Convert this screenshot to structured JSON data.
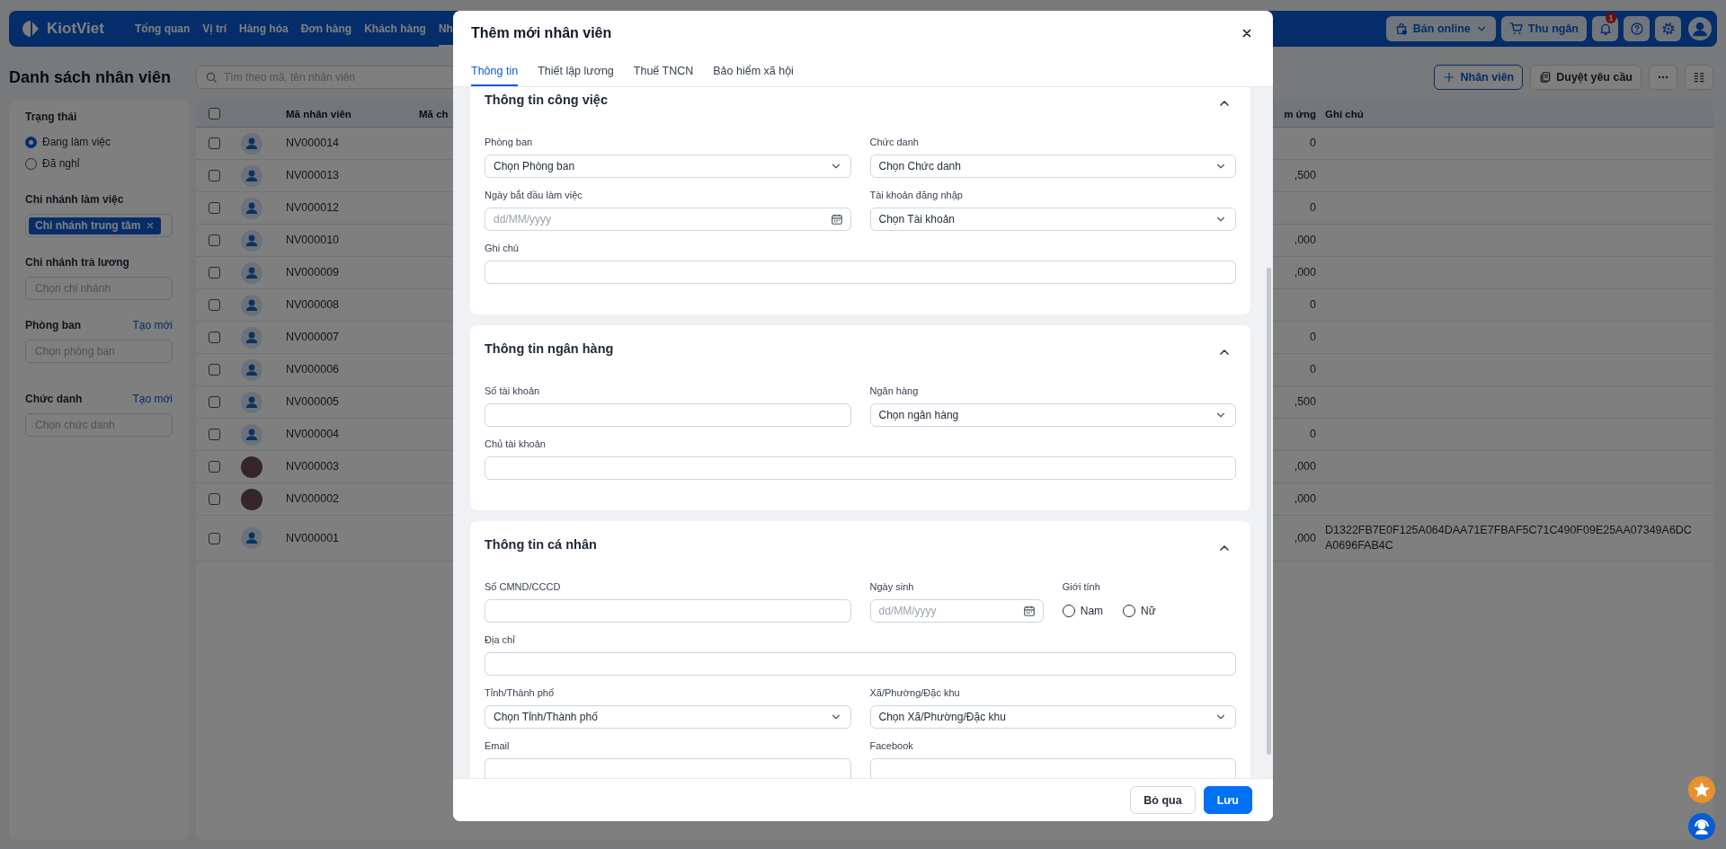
{
  "top_nav": {
    "logo": "KiotViet",
    "items": [
      {
        "label": "Tổng quan",
        "selected": false
      },
      {
        "label": "Vị trí",
        "selected": false
      },
      {
        "label": "Hàng hóa",
        "selected": false
      },
      {
        "label": "Đơn hàng",
        "selected": false
      },
      {
        "label": "Khách hàng",
        "selected": false
      },
      {
        "label": "Nh",
        "selected": true
      }
    ],
    "actions": [
      {
        "kind": "online",
        "label": "Bán online"
      },
      {
        "kind": "cashier",
        "label": "Thu ngân"
      },
      {
        "kind": "notifications",
        "badge": "1"
      },
      {
        "kind": "help"
      },
      {
        "kind": "settings"
      },
      {
        "kind": "account"
      }
    ]
  },
  "page": {
    "title": "Danh sách nhân viên",
    "search": {
      "placeholder": "Tìm theo mã, tên nhân viên"
    },
    "actions": [
      {
        "kind": "add",
        "label": "Nhân viên"
      },
      {
        "kind": "requests",
        "label": "Duyệt yêu cầu"
      },
      {
        "kind": "more"
      },
      {
        "kind": "layout"
      }
    ]
  },
  "filters": [
    {
      "kind": "radio",
      "title": "Trạng thái",
      "options": [
        {
          "label": "Đang làm việc",
          "selected": true
        },
        {
          "label": "Đã nghỉ",
          "selected": false
        }
      ]
    },
    {
      "kind": "tags",
      "title": "Chi nhánh làm việc",
      "tags": [
        "Chi nhánh trung tâm"
      ]
    },
    {
      "kind": "select",
      "title": "Chi nhánh trả lương",
      "placeholder": "Chọn chi nhánh"
    },
    {
      "kind": "select",
      "title": "Phòng ban",
      "link": "Tạo mới",
      "placeholder": "Chọn phòng ban"
    },
    {
      "kind": "select",
      "title": "Chức danh",
      "link": "Tạo mới",
      "placeholder": "Chọn chức danh"
    }
  ],
  "table": {
    "header_checkbox": {
      "checked": false
    },
    "columns": [
      {
        "kind": "code",
        "label": "Mã nhân viên"
      },
      {
        "kind": "hidden",
        "label": "Mã ch"
      },
      {
        "kind": "amount",
        "label": "m ứng"
      },
      {
        "kind": "note",
        "label": "Ghi chú"
      }
    ],
    "rows": [
      {
        "checked": false,
        "has_photo": false,
        "code": "NV000014",
        "amount": "0"
      },
      {
        "checked": false,
        "has_photo": false,
        "code": "NV000013",
        "amount": ",500"
      },
      {
        "checked": false,
        "has_photo": false,
        "code": "NV000012",
        "amount": "0"
      },
      {
        "checked": false,
        "has_photo": false,
        "code": "NV000010",
        "amount": ",000"
      },
      {
        "checked": false,
        "has_photo": false,
        "code": "NV000009",
        "amount": ",000"
      },
      {
        "checked": false,
        "has_photo": false,
        "code": "NV000008",
        "amount": "0"
      },
      {
        "checked": false,
        "has_photo": false,
        "code": "NV000007",
        "amount": "0"
      },
      {
        "checked": false,
        "has_photo": false,
        "code": "NV000006",
        "amount": "0"
      },
      {
        "checked": false,
        "has_photo": false,
        "code": "NV000005",
        "amount": ",500"
      },
      {
        "checked": false,
        "has_photo": false,
        "code": "NV000004",
        "amount": "0"
      },
      {
        "checked": false,
        "has_photo": true,
        "code": "NV000003",
        "amount": ",000"
      },
      {
        "checked": false,
        "has_photo": true,
        "code": "NV000002",
        "amount": ",000"
      },
      {
        "checked": false,
        "has_photo": false,
        "code": "NV000001",
        "amount": ",000",
        "note": "D1322FB7E0F125A064DAA71E7FBAF5C71C490F09E25AA07349A6DCA0696FAB4C"
      }
    ]
  },
  "modal": {
    "title": "Thêm mới nhân viên",
    "tabs": [
      {
        "label": "Thông tin",
        "selected": true
      },
      {
        "label": "Thiết lập lương",
        "selected": false
      },
      {
        "label": "Thuế TNCN",
        "selected": false
      },
      {
        "label": "Bảo hiểm xã hội",
        "selected": false
      }
    ],
    "sections": [
      {
        "title": "Thông tin công việc",
        "expanded": true,
        "rows": [
          [
            {
              "kind": "select",
              "label": "Phòng ban",
              "value": "Chọn Phòng ban"
            },
            {
              "kind": "select",
              "label": "Chức danh",
              "value": "Chọn Chức danh"
            }
          ],
          [
            {
              "kind": "date",
              "label": "Ngày bắt đầu làm việc",
              "placeholder": "dd/MM/yyyy"
            },
            {
              "kind": "select",
              "label": "Tài khoản đăng nhập",
              "value": "Chọn Tài khoản"
            }
          ],
          [
            {
              "kind": "text",
              "label": "Ghi chú"
            }
          ]
        ]
      },
      {
        "title": "Thông tin ngân hàng",
        "expanded": true,
        "rows": [
          [
            {
              "kind": "text",
              "label": "Số tài khoản"
            },
            {
              "kind": "select",
              "label": "Ngân hàng",
              "value": "Chọn ngân hàng"
            }
          ],
          [
            {
              "kind": "text",
              "label": "Chủ tài khoản"
            }
          ]
        ]
      },
      {
        "title": "Thông tin cá nhân",
        "expanded": true,
        "rows": [
          [
            {
              "kind": "text",
              "label": "Số CMND/CCCD"
            },
            {
              "kind": "date",
              "label": "Ngày sinh",
              "placeholder": "dd/MM/yyyy"
            },
            {
              "kind": "radio",
              "label": "Giới tính",
              "options": [
                {
                  "label": "Nam",
                  "selected": false
                },
                {
                  "label": "Nữ",
                  "selected": false
                }
              ]
            }
          ],
          [
            {
              "kind": "text",
              "label": "Địa chỉ"
            }
          ],
          [
            {
              "kind": "select",
              "label": "Tỉnh/Thành phố",
              "value": "Chọn Tỉnh/Thành phố"
            },
            {
              "kind": "select",
              "label": "Xã/Phường/Đặc khu",
              "value": "Chọn Xã/Phường/Đặc khu"
            }
          ],
          [
            {
              "kind": "text",
              "label": "Email"
            },
            {
              "kind": "text",
              "label": "Facebook"
            }
          ]
        ]
      }
    ],
    "buttons": [
      {
        "kind": "secondary",
        "label": "Bỏ qua"
      },
      {
        "kind": "primary",
        "label": "Lưu"
      }
    ]
  },
  "floating": [
    {
      "kind": "star"
    },
    {
      "kind": "support"
    }
  ]
}
